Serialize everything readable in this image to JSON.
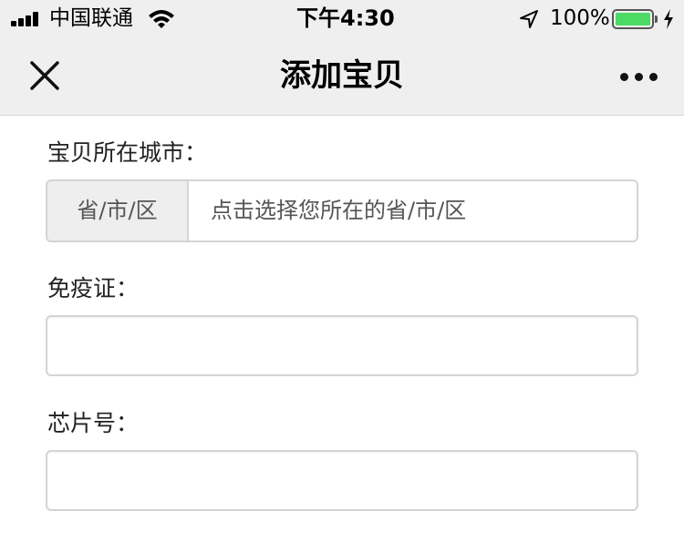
{
  "status_bar": {
    "carrier": "中国联通",
    "time": "下午4:30",
    "battery_percent": "100%",
    "battery_level": 1.0,
    "battery_color": "#4cd964",
    "icons": [
      "signal-bars-icon",
      "wifi-icon",
      "location-arrow-icon",
      "battery-icon",
      "charging-bolt-icon"
    ]
  },
  "nav": {
    "title": "添加宝贝",
    "close_icon": "close-icon",
    "more_icon": "more-dots-icon"
  },
  "form": {
    "city": {
      "label": "宝贝所在城市",
      "colon": "：",
      "addon": "省/市/区",
      "placeholder": "点击选择您所在的省/市/区"
    },
    "immunity": {
      "label": "免疫证",
      "colon": "：",
      "value": ""
    },
    "chip": {
      "label": "芯片号",
      "colon": "：",
      "value": ""
    }
  },
  "colors": {
    "header_bg": "#efefef",
    "border": "#d4d4d4",
    "addon_bg": "#eeeeee"
  }
}
